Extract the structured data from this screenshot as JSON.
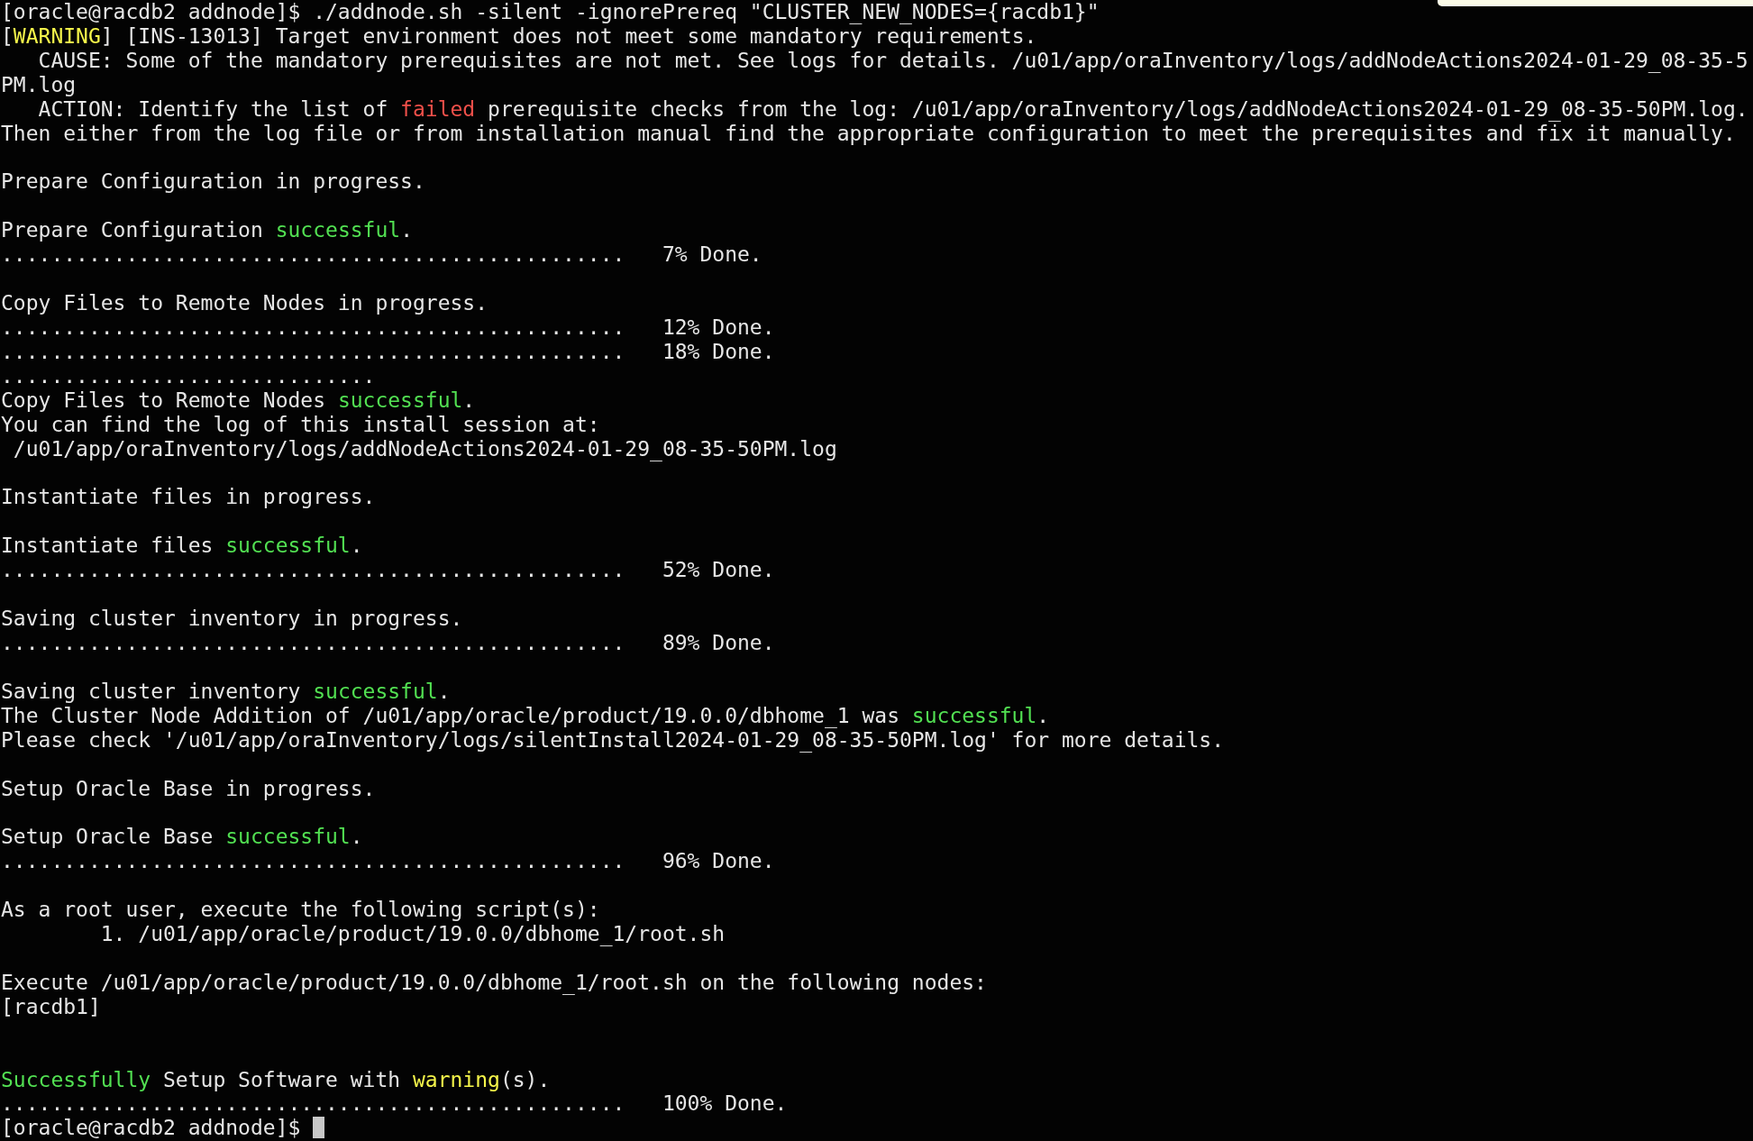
{
  "terminal": {
    "lines": [
      {
        "kind": "text",
        "segments": [
          {
            "kind": "plain",
            "text": "[oracle@racdb2 addnode]$ ./addnode.sh -silent -ignorePrereq \"CLUSTER_NEW_NODES={racdb1}\""
          }
        ]
      },
      {
        "kind": "text",
        "segments": [
          {
            "kind": "plain",
            "text": "["
          },
          {
            "kind": "warning",
            "text": "WARNING"
          },
          {
            "kind": "plain",
            "text": "] [INS-13013] Target environment does not meet some mandatory requirements."
          }
        ]
      },
      {
        "kind": "text",
        "segments": [
          {
            "kind": "plain",
            "text": "   CAUSE: Some of the mandatory prerequisites are not met. See logs for details. /u01/app/oraInventory/logs/addNodeActions2024-01-29_08-35-5"
          }
        ]
      },
      {
        "kind": "text",
        "segments": [
          {
            "kind": "plain",
            "text": "PM.log"
          }
        ]
      },
      {
        "kind": "text",
        "segments": [
          {
            "kind": "plain",
            "text": "   ACTION: Identify the list of "
          },
          {
            "kind": "failed",
            "text": "failed"
          },
          {
            "kind": "plain",
            "text": " prerequisite checks from the log: /u01/app/oraInventory/logs/addNodeActions2024-01-29_08-35-50PM.log."
          }
        ]
      },
      {
        "kind": "text",
        "segments": [
          {
            "kind": "plain",
            "text": "Then either from the log file or from installation manual find the appropriate configuration to meet the prerequisites and fix it manually."
          }
        ]
      },
      {
        "kind": "blank"
      },
      {
        "kind": "text",
        "segments": [
          {
            "kind": "plain",
            "text": "Prepare Configuration in progress."
          }
        ]
      },
      {
        "kind": "blank"
      },
      {
        "kind": "text",
        "segments": [
          {
            "kind": "plain",
            "text": "Prepare Configuration "
          },
          {
            "kind": "success",
            "text": "successful"
          },
          {
            "kind": "plain",
            "text": "."
          }
        ]
      },
      {
        "kind": "text",
        "segments": [
          {
            "kind": "plain",
            "text": "..................................................   7% Done."
          }
        ]
      },
      {
        "kind": "blank"
      },
      {
        "kind": "text",
        "segments": [
          {
            "kind": "plain",
            "text": "Copy Files to Remote Nodes in progress."
          }
        ]
      },
      {
        "kind": "text",
        "segments": [
          {
            "kind": "plain",
            "text": "..................................................   12% Done."
          }
        ]
      },
      {
        "kind": "text",
        "segments": [
          {
            "kind": "plain",
            "text": "..................................................   18% Done."
          }
        ]
      },
      {
        "kind": "text",
        "segments": [
          {
            "kind": "plain",
            "text": ".............................."
          }
        ]
      },
      {
        "kind": "text",
        "segments": [
          {
            "kind": "plain",
            "text": "Copy Files to Remote Nodes "
          },
          {
            "kind": "success",
            "text": "successful"
          },
          {
            "kind": "plain",
            "text": "."
          }
        ]
      },
      {
        "kind": "text",
        "segments": [
          {
            "kind": "plain",
            "text": "You can find the log of this install session at:"
          }
        ]
      },
      {
        "kind": "text",
        "segments": [
          {
            "kind": "plain",
            "text": " /u01/app/oraInventory/logs/addNodeActions2024-01-29_08-35-50PM.log"
          }
        ]
      },
      {
        "kind": "blank"
      },
      {
        "kind": "text",
        "segments": [
          {
            "kind": "plain",
            "text": "Instantiate files in progress."
          }
        ]
      },
      {
        "kind": "blank"
      },
      {
        "kind": "text",
        "segments": [
          {
            "kind": "plain",
            "text": "Instantiate files "
          },
          {
            "kind": "success",
            "text": "successful"
          },
          {
            "kind": "plain",
            "text": "."
          }
        ]
      },
      {
        "kind": "text",
        "segments": [
          {
            "kind": "plain",
            "text": "..................................................   52% Done."
          }
        ]
      },
      {
        "kind": "blank"
      },
      {
        "kind": "text",
        "segments": [
          {
            "kind": "plain",
            "text": "Saving cluster inventory in progress."
          }
        ]
      },
      {
        "kind": "text",
        "segments": [
          {
            "kind": "plain",
            "text": "..................................................   89% Done."
          }
        ]
      },
      {
        "kind": "blank"
      },
      {
        "kind": "text",
        "segments": [
          {
            "kind": "plain",
            "text": "Saving cluster inventory "
          },
          {
            "kind": "success",
            "text": "successful"
          },
          {
            "kind": "plain",
            "text": "."
          }
        ]
      },
      {
        "kind": "text",
        "segments": [
          {
            "kind": "plain",
            "text": "The Cluster Node Addition of /u01/app/oracle/product/19.0.0/dbhome_1 was "
          },
          {
            "kind": "success",
            "text": "successful"
          },
          {
            "kind": "plain",
            "text": "."
          }
        ]
      },
      {
        "kind": "text",
        "segments": [
          {
            "kind": "plain",
            "text": "Please check '/u01/app/oraInventory/logs/silentInstall2024-01-29_08-35-50PM.log' for more details."
          }
        ]
      },
      {
        "kind": "blank"
      },
      {
        "kind": "text",
        "segments": [
          {
            "kind": "plain",
            "text": "Setup Oracle Base in progress."
          }
        ]
      },
      {
        "kind": "blank"
      },
      {
        "kind": "text",
        "segments": [
          {
            "kind": "plain",
            "text": "Setup Oracle Base "
          },
          {
            "kind": "success",
            "text": "successful"
          },
          {
            "kind": "plain",
            "text": "."
          }
        ]
      },
      {
        "kind": "text",
        "segments": [
          {
            "kind": "plain",
            "text": "..................................................   96% Done."
          }
        ]
      },
      {
        "kind": "blank"
      },
      {
        "kind": "text",
        "segments": [
          {
            "kind": "plain",
            "text": "As a root user, execute the following script(s):"
          }
        ]
      },
      {
        "kind": "text",
        "segments": [
          {
            "kind": "plain",
            "text": "        1. /u01/app/oracle/product/19.0.0/dbhome_1/root.sh"
          }
        ]
      },
      {
        "kind": "blank"
      },
      {
        "kind": "text",
        "segments": [
          {
            "kind": "plain",
            "text": "Execute /u01/app/oracle/product/19.0.0/dbhome_1/root.sh on the following nodes:"
          }
        ]
      },
      {
        "kind": "text",
        "segments": [
          {
            "kind": "plain",
            "text": "[racdb1]"
          }
        ]
      },
      {
        "kind": "blank"
      },
      {
        "kind": "blank"
      },
      {
        "kind": "text",
        "segments": [
          {
            "kind": "success",
            "text": "Successfully"
          },
          {
            "kind": "plain",
            "text": " Setup Software with "
          },
          {
            "kind": "warning",
            "text": "warning"
          },
          {
            "kind": "plain",
            "text": "(s)."
          }
        ]
      },
      {
        "kind": "text",
        "segments": [
          {
            "kind": "plain",
            "text": "..................................................   100% Done."
          }
        ]
      },
      {
        "kind": "text",
        "cursor": true,
        "segments": [
          {
            "kind": "plain",
            "text": "[oracle@racdb2 addnode]$ "
          }
        ]
      }
    ]
  }
}
